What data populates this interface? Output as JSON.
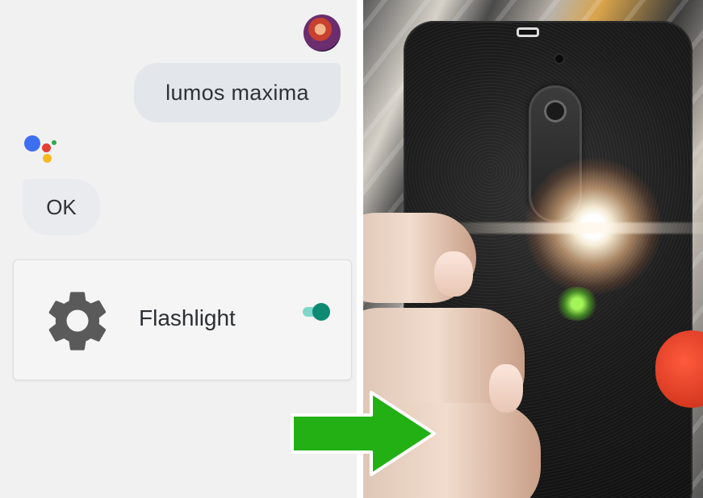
{
  "assistant": {
    "user_message": "lumos maxima",
    "reply": "OK",
    "card": {
      "label": "Flashlight",
      "toggle_state": "on",
      "icon": "gear-icon"
    }
  },
  "icons": {
    "avatar": "user-avatar",
    "logo": "google-assistant-logo-icon",
    "arrow": "green-arrow-icon"
  },
  "colors": {
    "assistant_blue": "#3d6ff0",
    "assistant_red": "#e53f34",
    "assistant_yellow": "#f7b920",
    "assistant_green": "#2fa84f",
    "toggle_on": "#0f8a72",
    "arrow": "#22b014"
  }
}
